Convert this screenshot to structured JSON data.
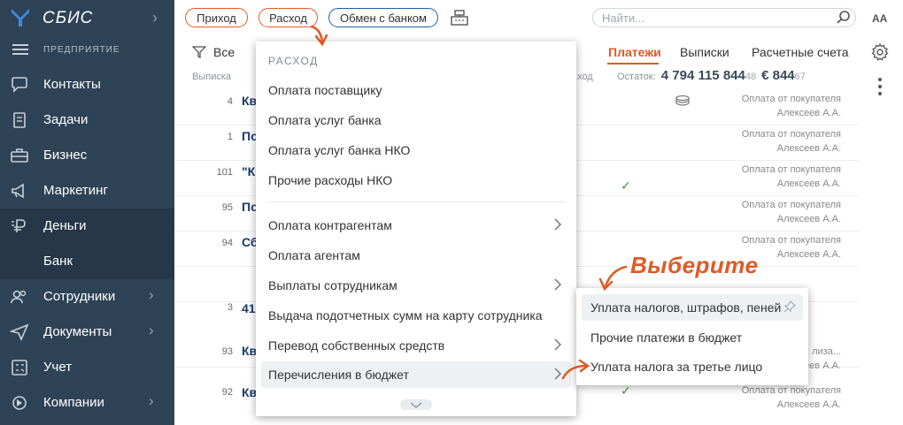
{
  "app": {
    "name": "СБИС",
    "org_label": "ПРЕДПРИЯТИЕ"
  },
  "sidebar": {
    "items": [
      {
        "label": "Контакты",
        "icon": "chat-icon",
        "has_arrow": false
      },
      {
        "label": "Задачи",
        "icon": "clipboard-icon",
        "has_arrow": false
      },
      {
        "label": "Бизнес",
        "icon": "briefcase-icon",
        "has_arrow": false
      },
      {
        "label": "Маркетинг",
        "icon": "megaphone-icon",
        "has_arrow": false
      },
      {
        "label": "Деньги",
        "icon": "ruble-icon",
        "has_arrow": false
      },
      {
        "label": "Банк",
        "icon": "",
        "has_arrow": false
      },
      {
        "label": "Сотрудники",
        "icon": "people-icon",
        "has_arrow": true
      },
      {
        "label": "Документы",
        "icon": "send-icon",
        "has_arrow": true
      },
      {
        "label": "Учет",
        "icon": "calculator-icon",
        "has_arrow": false
      },
      {
        "label": "Компании",
        "icon": "companies-icon",
        "has_arrow": true
      }
    ]
  },
  "topbar": {
    "buttons": [
      "Приход",
      "Расход",
      "Обмен с банком"
    ],
    "search_placeholder": "Найти...",
    "font_toggle": "AA"
  },
  "toolbar": {
    "filter_label": "Все",
    "tabs": [
      "Платежи",
      "Выписки",
      "Расчетные счета"
    ],
    "active_tab": "Платежи"
  },
  "table": {
    "headers": {
      "statement": "Выписка",
      "income": "ход"
    },
    "balance": {
      "label": "Остаток:",
      "rub_main": "4 794 115 844",
      "rub_kop": "48",
      "eur_main": "€ 844",
      "eur_cent": "67"
    },
    "rows": [
      {
        "num": "4",
        "title": "Кв",
        "category": "Оплата от покупателя",
        "person": "Алексеев А.А.",
        "check": false
      },
      {
        "num": "1",
        "title": "По",
        "category": "Оплата от покупателя",
        "person": "Алексеев А.А.",
        "check": false
      },
      {
        "num": "101",
        "title": "\"К",
        "category": "Оплата от покупателя",
        "person": "Алексеев А.А.",
        "check": true
      },
      {
        "num": "95",
        "title": "По",
        "category": "Оплата от покупателя",
        "person": "Алексеев А.А.",
        "check": false
      },
      {
        "num": "94",
        "title": "Сб",
        "category": "Оплата от покупателя",
        "person": "Алексеев А.А.",
        "check": false
      },
      {
        "num": "3",
        "title": "41",
        "category": "",
        "person": "",
        "check": false
      },
      {
        "num": "93",
        "title": "Кв",
        "category": "лиза...",
        "person": "Алексеев А.А.",
        "check": false
      },
      {
        "num": "92",
        "title": "Кв",
        "category": "Оплата от покупателя",
        "person": "Алексеев А.А.",
        "check": true
      }
    ]
  },
  "menu": {
    "header": "РАСХОД",
    "items": [
      {
        "label": "Оплата поставщику",
        "submenu": false
      },
      {
        "label": "Оплата услуг банка",
        "submenu": false
      },
      {
        "label": "Оплата услуг банка НКО",
        "submenu": false
      },
      {
        "label": "Прочие расходы НКО",
        "submenu": false
      },
      {
        "label": "Оплата контрагентам",
        "submenu": true
      },
      {
        "label": "Оплата агентам",
        "submenu": false
      },
      {
        "label": "Выплаты сотрудникам",
        "submenu": true
      },
      {
        "label": "Выдача подотчетных сумм на карту сотрудника",
        "submenu": false
      },
      {
        "label": "Перевод собственных средств",
        "submenu": true
      },
      {
        "label": "Перечисления в бюджет",
        "submenu": true
      }
    ]
  },
  "submenu": {
    "items": [
      "Уплата налогов, штрафов, пеней",
      "Прочие платежи в бюджет",
      "Уплата налога за третье лицо"
    ]
  },
  "callout": "Выберите",
  "colors": {
    "sidebar": "#2f4356",
    "accent": "#e05a23",
    "bank_blue": "#1c5fa4",
    "title_blue": "#1c3a6e"
  }
}
